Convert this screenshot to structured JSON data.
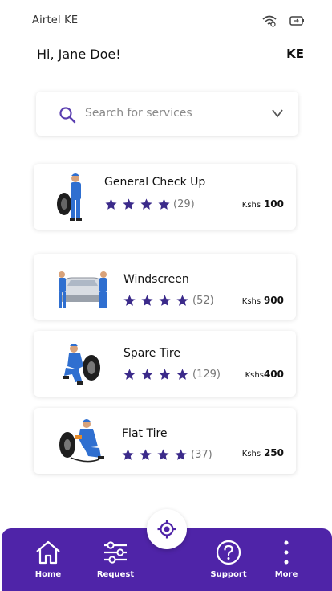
{
  "status_bar": {
    "carrier": "Airtel KE",
    "icons": [
      "wifi-icon",
      "battery-icon"
    ]
  },
  "header": {
    "greeting": "Hi, Jane Doe!",
    "country_code": "KE"
  },
  "search": {
    "placeholder": "Search for services",
    "icon": "search-icon",
    "dropdown_icon": "chevron-down-icon"
  },
  "colors": {
    "accent": "#4f24a8",
    "star": "#3b2a8a",
    "mechanic_blue": "#2f6fd0"
  },
  "services": [
    {
      "title": "General Check Up",
      "rating": 4,
      "reviews": "(29)",
      "currency": "Kshs",
      "price": "100"
    },
    {
      "title": "Windscreen",
      "rating": 4,
      "reviews": "(52)",
      "currency": "Kshs",
      "price": "900"
    },
    {
      "title": "Spare Tire",
      "rating": 4,
      "reviews": "(129)",
      "currency": "Kshs",
      "price": "400"
    },
    {
      "title": "Flat Tire",
      "rating": 4,
      "reviews": "(37)",
      "currency": "Kshs",
      "price": "250"
    }
  ],
  "bottom_nav": {
    "items": [
      {
        "label": "Home",
        "icon": "home-icon"
      },
      {
        "label": "Request",
        "icon": "sliders-icon"
      },
      {
        "label": "Support",
        "icon": "help-icon"
      },
      {
        "label": "More",
        "icon": "more-icon"
      }
    ],
    "center_icon": "locate-icon"
  }
}
